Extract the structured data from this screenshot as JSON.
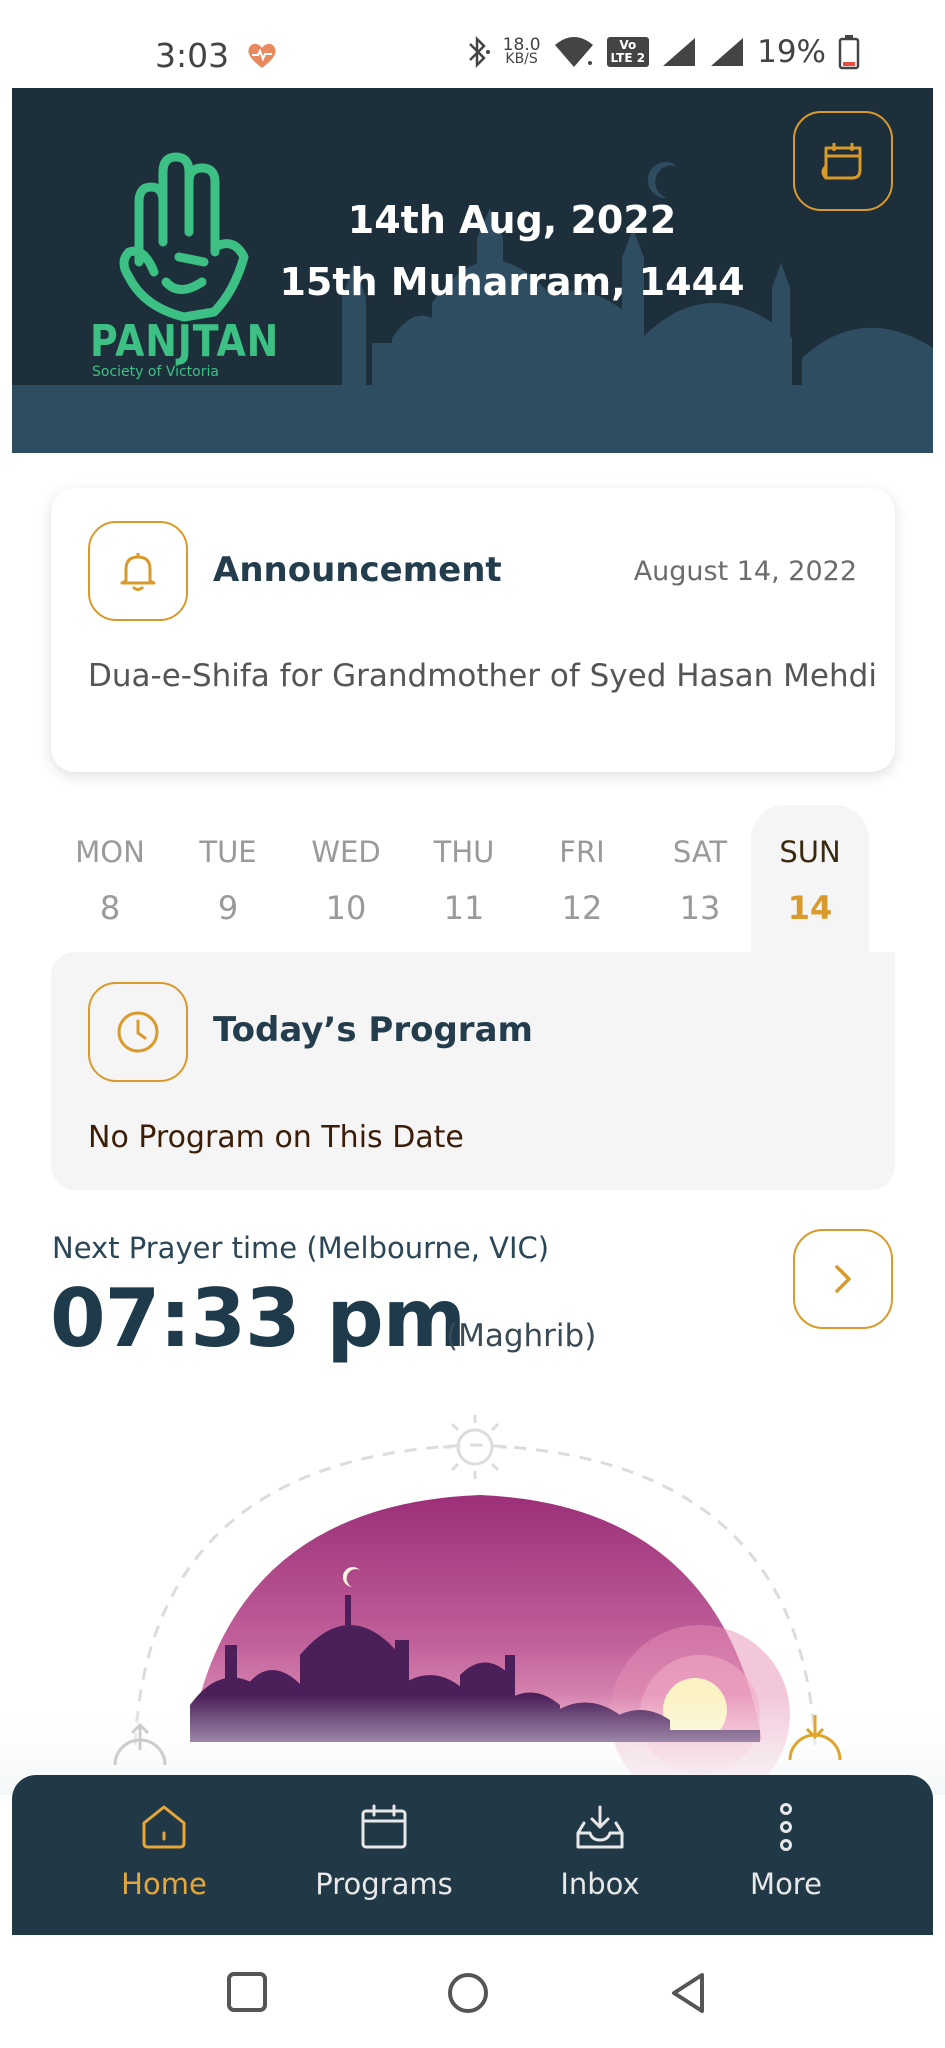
{
  "status_bar": {
    "time": "3:03",
    "net_speed_value": "18.0",
    "net_speed_unit": "KB/S",
    "volte_top": "Vo",
    "volte_bottom": "LTE 2",
    "battery": "19%"
  },
  "header": {
    "logo_name": "PANJTAN",
    "logo_subtitle": "Society of Victoria",
    "date_gregorian": "14th Aug, 2022",
    "date_hijri": "15th Muharram, 1444",
    "calendar_icon": "calendar-icon"
  },
  "announcement": {
    "title": "Announcement",
    "date": "August 14, 2022",
    "text": "Dua-e-Shifa for Grandmother of Syed Hasan Mehdi",
    "icon": "bell-icon"
  },
  "week": {
    "days": [
      {
        "name": "MON",
        "date": "8"
      },
      {
        "name": "TUE",
        "date": "9"
      },
      {
        "name": "WED",
        "date": "10"
      },
      {
        "name": "THU",
        "date": "11"
      },
      {
        "name": "FRI",
        "date": "12"
      },
      {
        "name": "SAT",
        "date": "13"
      },
      {
        "name": "SUN",
        "date": "14"
      }
    ],
    "selected": "SUN"
  },
  "program": {
    "title": "Today’s Program",
    "text": "No Program on This Date",
    "icon": "clock-icon"
  },
  "next_prayer": {
    "label": "Next Prayer time (Melbourne, VIC)",
    "time": "07:33 pm",
    "name": "(Maghrib)"
  },
  "bottom_nav": {
    "items": [
      {
        "label": "Home",
        "icon": "home-icon",
        "active": true
      },
      {
        "label": "Programs",
        "icon": "calendar-icon",
        "active": false
      },
      {
        "label": "Inbox",
        "icon": "inbox-icon",
        "active": false
      },
      {
        "label": "More",
        "icon": "more-vertical-icon",
        "active": false
      }
    ]
  },
  "colors": {
    "accent": "#d99a2b",
    "header_bg": "#1d2f3b",
    "nav_bg": "#213947",
    "brand_green": "#3cc083"
  }
}
